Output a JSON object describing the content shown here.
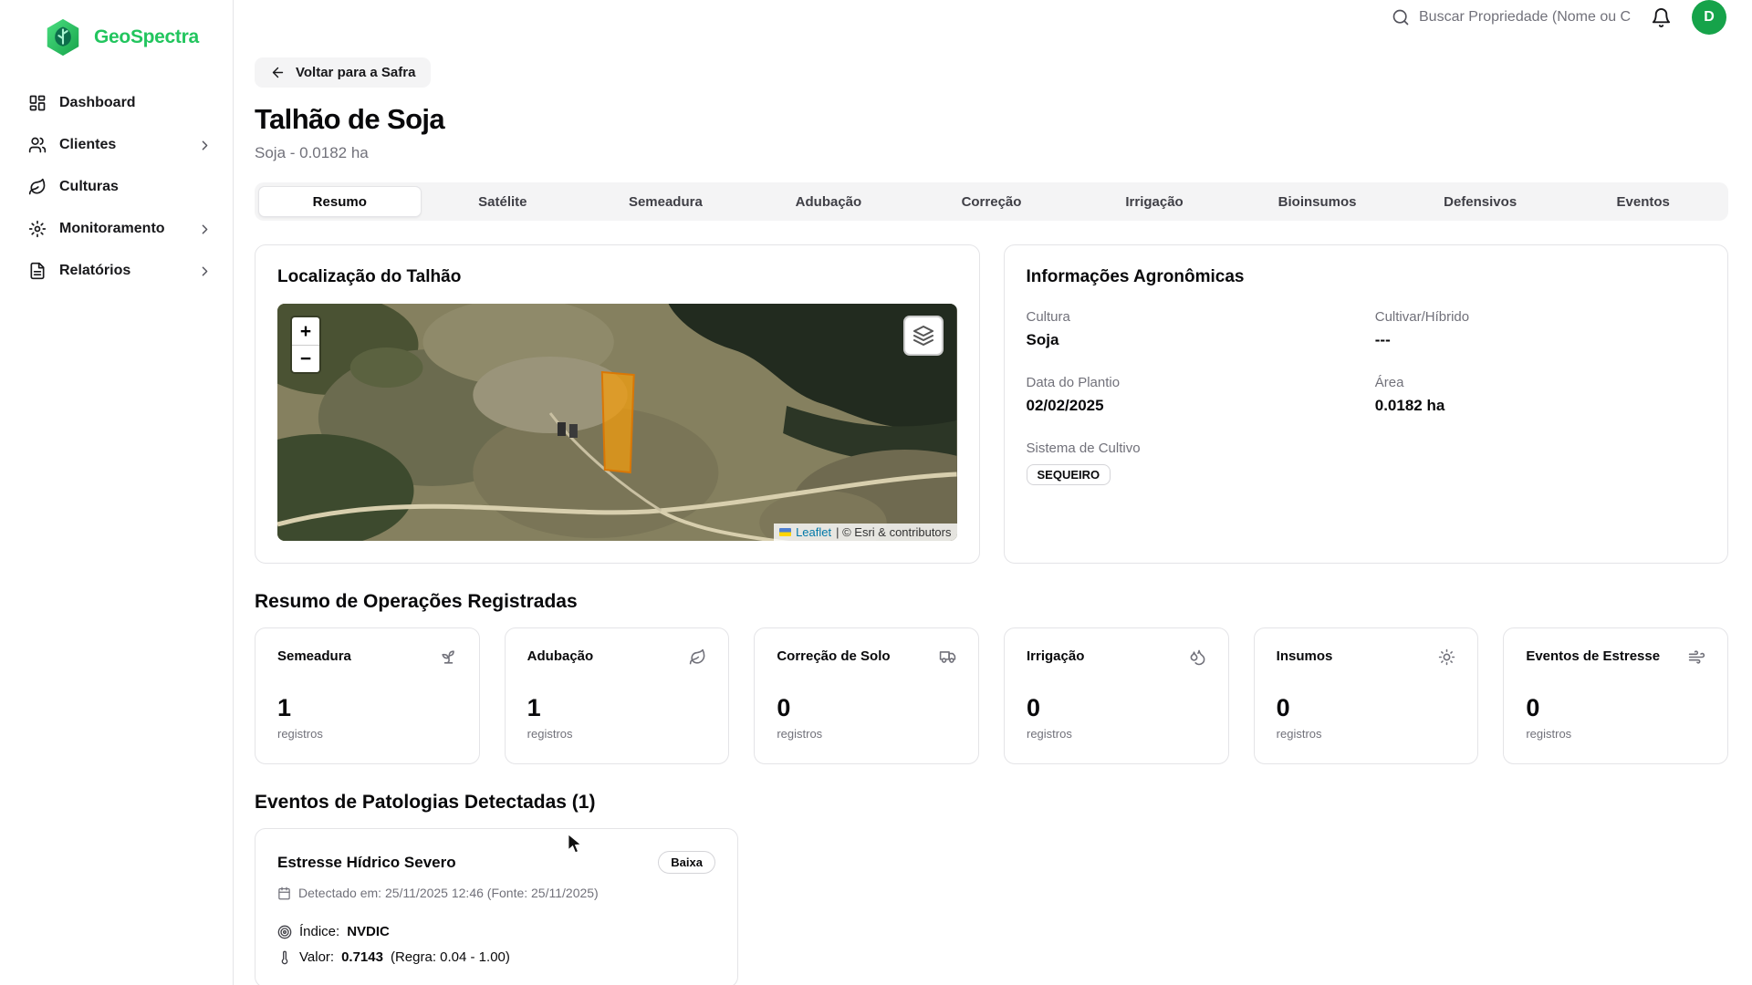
{
  "colors": {
    "brand": "#22c55e",
    "avatar": "#16a34a",
    "field_polygon": "#f59e0b",
    "link": "#0078a8"
  },
  "brand": {
    "name": "GeoSpectra"
  },
  "header": {
    "search_placeholder": "Buscar Propriedade (Nome ou C",
    "avatar_initial": "D"
  },
  "sidebar": {
    "items": [
      {
        "label": "Dashboard",
        "icon": "dashboard-icon",
        "expandable": false
      },
      {
        "label": "Clientes",
        "icon": "users-icon",
        "expandable": true
      },
      {
        "label": "Culturas",
        "icon": "leaf-icon",
        "expandable": false
      },
      {
        "label": "Monitoramento",
        "icon": "gear-icon",
        "expandable": true
      },
      {
        "label": "Relatórios",
        "icon": "report-icon",
        "expandable": true
      }
    ]
  },
  "page": {
    "back_button": "Voltar para a Safra",
    "title": "Talhão de Soja",
    "subtitle": "Soja - 0.0182 ha",
    "active_tab": "Resumo",
    "tabs": [
      "Resumo",
      "Satélite",
      "Semeadura",
      "Adubação",
      "Correção",
      "Irrigação",
      "Bioinsumos",
      "Defensivos",
      "Eventos"
    ]
  },
  "location_card": {
    "title": "Localização do Talhão",
    "zoom_in": "+",
    "zoom_out": "−",
    "attribution_link": "Leaflet",
    "attribution_rest": "| © Esri & contributors"
  },
  "agro_card": {
    "title": "Informações Agronômicas",
    "fields": [
      {
        "label": "Cultura",
        "value": "Soja"
      },
      {
        "label": "Cultivar/Híbrido",
        "value": "---"
      },
      {
        "label": "Data do Plantio",
        "value": "02/02/2025"
      },
      {
        "label": "Área",
        "value": "0.0182 ha"
      }
    ],
    "sistema_label": "Sistema de Cultivo",
    "sistema_value": "SEQUEIRO"
  },
  "operations": {
    "title": "Resumo de Operações Registradas",
    "unit": "registros",
    "cards": [
      {
        "label": "Semeadura",
        "count": "1",
        "icon": "sprout-icon"
      },
      {
        "label": "Adubação",
        "count": "1",
        "icon": "leaf-icon"
      },
      {
        "label": "Correção de Solo",
        "count": "0",
        "icon": "tractor-icon"
      },
      {
        "label": "Irrigação",
        "count": "0",
        "icon": "droplets-icon"
      },
      {
        "label": "Insumos",
        "count": "0",
        "icon": "sun-icon"
      },
      {
        "label": "Eventos de Estresse",
        "count": "0",
        "icon": "wind-icon"
      }
    ]
  },
  "pathologies": {
    "title": "Eventos de Patologias Detectadas (1)",
    "events": [
      {
        "name": "Estresse Hídrico Severo",
        "severity": "Baixa",
        "detected": "Detectado em: 25/11/2025 12:46 (Fonte: 25/11/2025)",
        "index_label": "Índice:",
        "index_value": "NVDIC",
        "value_label": "Valor:",
        "value_value": "0.7143",
        "value_rule": "(Regra: 0.04 - 1.00)"
      }
    ]
  }
}
